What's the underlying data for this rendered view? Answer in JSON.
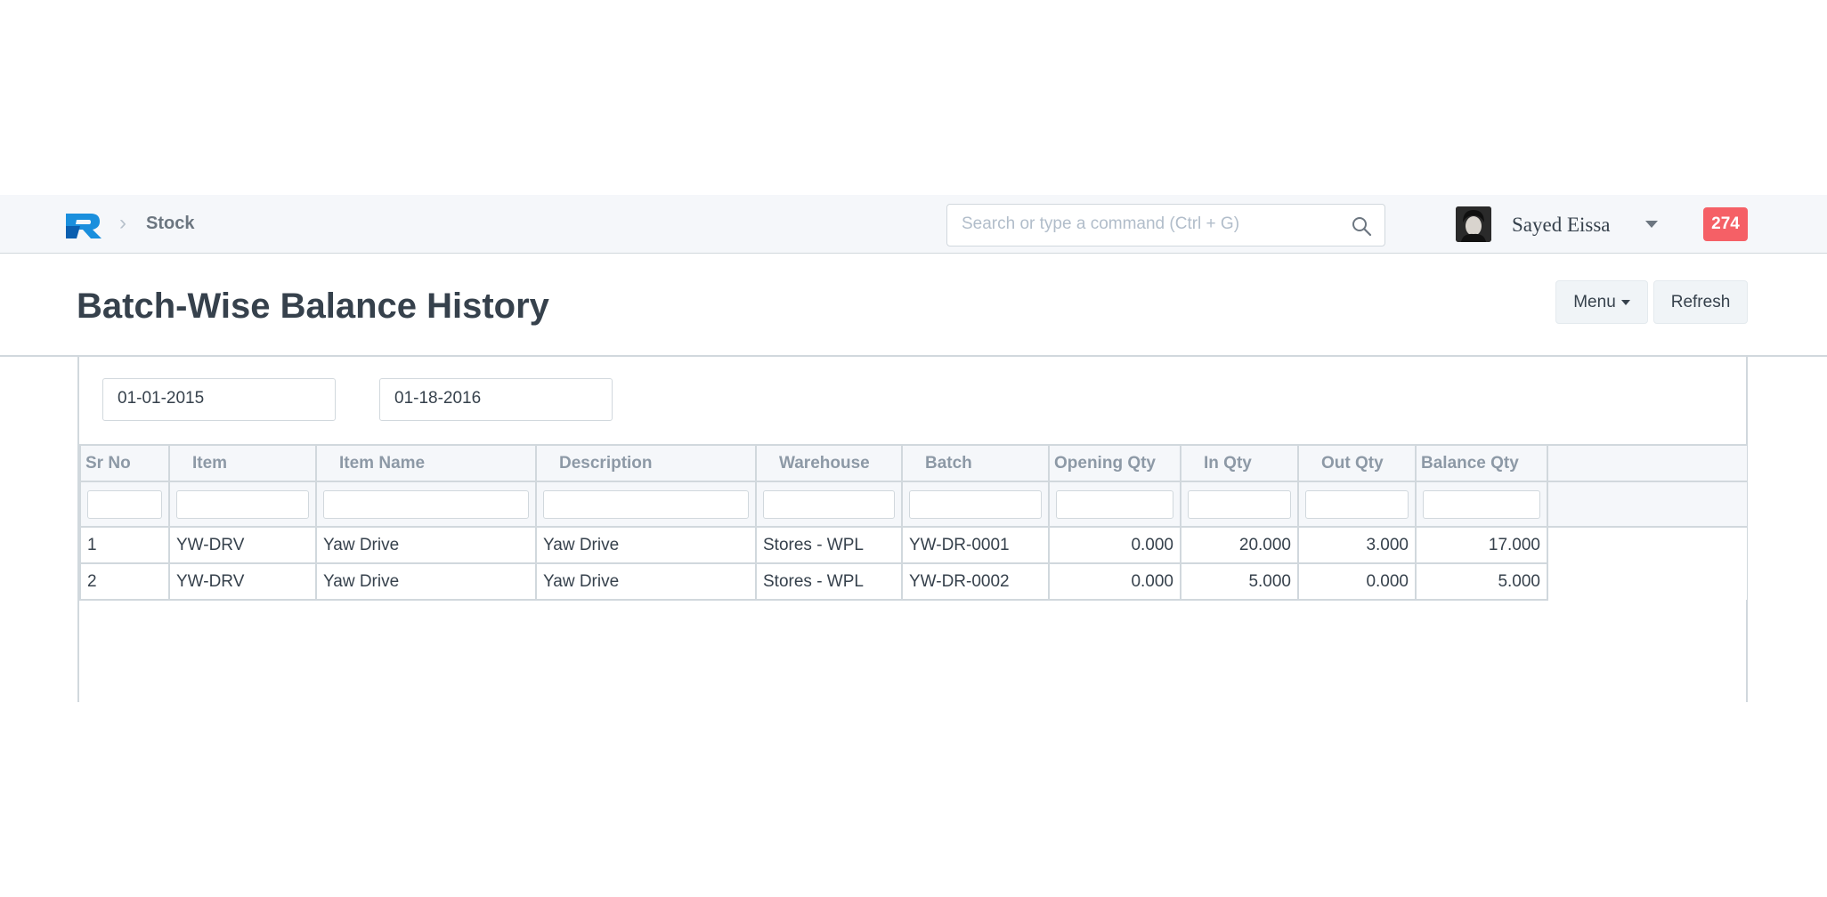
{
  "navbar": {
    "breadcrumb": "Stock",
    "search_placeholder": "Search or type a command (Ctrl + G)",
    "user_name": "Sayed Eissa",
    "notification_count": "274"
  },
  "page": {
    "title": "Batch-Wise Balance History",
    "menu_label": "Menu",
    "refresh_label": "Refresh"
  },
  "filters": {
    "from_date": "01-01-2015",
    "to_date": "01-18-2016"
  },
  "table": {
    "columns": [
      "Sr No",
      "Item",
      "Item Name",
      "Description",
      "Warehouse",
      "Batch",
      "Opening Qty",
      "In Qty",
      "Out Qty",
      "Balance Qty"
    ],
    "rows": [
      [
        "1",
        "YW-DRV",
        "Yaw Drive",
        "Yaw Drive",
        "Stores - WPL",
        "YW-DR-0001",
        "0.000",
        "20.000",
        "3.000",
        "17.000"
      ],
      [
        "2",
        "YW-DRV",
        "Yaw Drive",
        "Yaw Drive",
        "Stores - WPL",
        "YW-DR-0002",
        "0.000",
        "5.000",
        "0.000",
        "5.000"
      ]
    ]
  },
  "colors": {
    "brand_blue": "#1a8fdd",
    "badge_red": "#f56066",
    "navbar_bg": "#f5f7fa"
  }
}
